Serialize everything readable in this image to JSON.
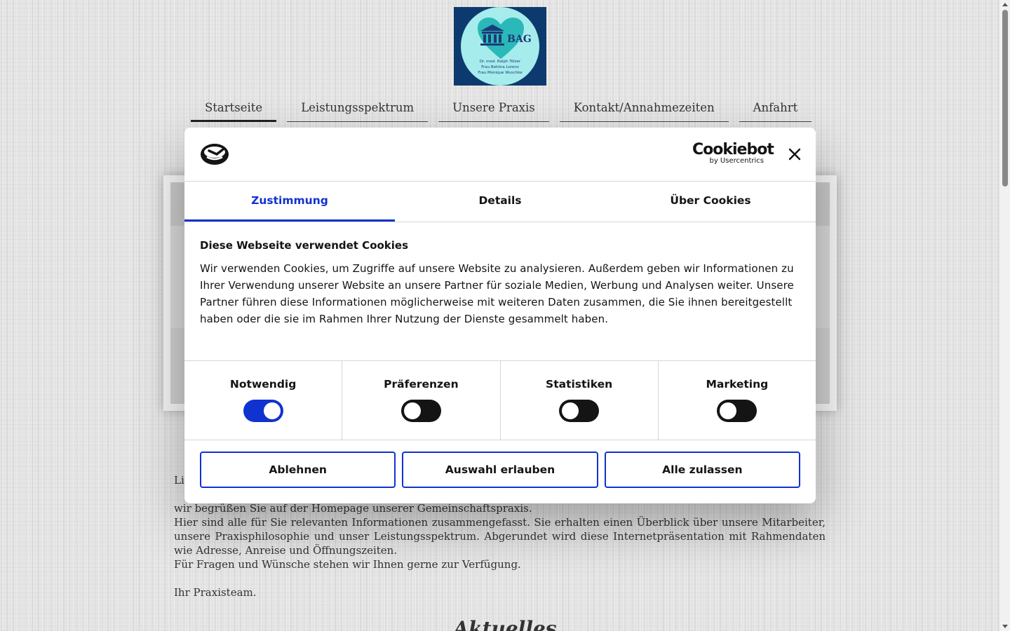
{
  "logo": {
    "abbrev": "BAG",
    "names": [
      "Dr. med. Ralph Tölzer",
      "Frau Bettina Lorenz",
      "Frau Monique Wuschke"
    ]
  },
  "nav": {
    "items": [
      {
        "label": "Startseite",
        "active": true
      },
      {
        "label": "Leistungsspektrum",
        "active": false
      },
      {
        "label": "Unsere Praxis",
        "active": false
      },
      {
        "label": "Kontakt/Annahmezeiten",
        "active": false
      },
      {
        "label": "Anfahrt",
        "active": false
      }
    ]
  },
  "content": {
    "salutation": "Li",
    "paragraph1": "wir begrüßen Sie auf der Homepage unserer Gemeinschaftspraxis.",
    "paragraph2": "Hier sind alle für Sie relevanten Informationen zusammengefasst. Sie erhalten einen Überblick über unsere Mitarbeiter, unsere Praxisphilosophie und unser Leistungsspektrum. Abgerundet wird diese Internetpräsentation mit Rahmendaten wie Adresse, Anreise und Öffnungszeiten.",
    "paragraph3": "Für Fragen und Wünsche stehen wir Ihnen gerne zur Verfügung.",
    "signoff": "Ihr Praxisteam.",
    "section_heading": "Aktuelles"
  },
  "cookie": {
    "brand_name": "Cookiebot",
    "brand_sub": "by Usercentrics",
    "tabs": [
      {
        "label": "Zustimmung",
        "active": true
      },
      {
        "label": "Details",
        "active": false
      },
      {
        "label": "Über Cookies",
        "active": false
      }
    ],
    "title": "Diese Webseite verwendet Cookies",
    "text": "Wir verwenden Cookies, um Zugriffe auf unsere Website zu analysieren. Außerdem geben wir Informationen zu Ihrer Verwendung unserer Website an unsere Partner für soziale Medien, Werbung und Analysen weiter. Unsere Partner führen diese Informationen möglicherweise mit weiteren Daten zusammen, die Sie ihnen bereitgestellt haben oder die sie im Rahmen Ihrer Nutzung der Dienste gesammelt haben.",
    "toggles": [
      {
        "label": "Notwendig",
        "on": true
      },
      {
        "label": "Präferenzen",
        "on": false
      },
      {
        "label": "Statistiken",
        "on": false
      },
      {
        "label": "Marketing",
        "on": false
      }
    ],
    "buttons": {
      "decline": "Ablehnen",
      "allow_selection": "Auswahl erlauben",
      "allow_all": "Alle zulassen"
    },
    "accent_color": "#1032cf"
  },
  "icons": {
    "logo_heart": "heart-icon",
    "logo_building": "building-icon",
    "cookiebot_logo": "cookiebot-logo-icon",
    "close": "close-icon"
  }
}
